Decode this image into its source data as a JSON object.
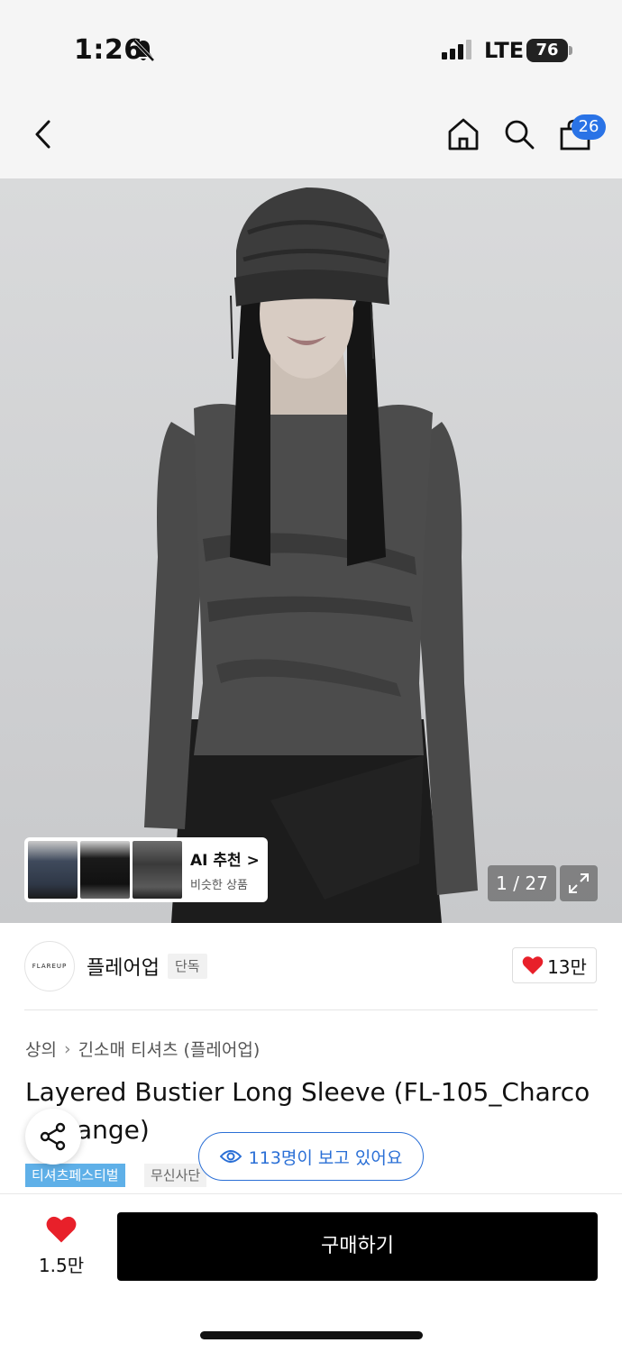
{
  "status_bar": {
    "time": "1:26",
    "network": "LTE",
    "battery": "76",
    "icons": [
      "bell-slash-icon",
      "signal-icon"
    ]
  },
  "header": {
    "back_icon": "chevron-left-icon",
    "home_icon": "home-icon",
    "search_icon": "search-icon",
    "cart_icon": "shopping-bag-icon",
    "cart_count": "26"
  },
  "gallery": {
    "counter": "1 / 27",
    "expand_icon": "expand-icon",
    "ai_recommend": {
      "title": "AI 추천 >",
      "subtitle": "비슷한 상품"
    }
  },
  "brand": {
    "logo_text": "FLAREUP",
    "name": "플레어업",
    "tag": "단독",
    "likes": "13만"
  },
  "product": {
    "breadcrumb": [
      "상의",
      "긴소매 티셔츠 (플레어업)"
    ],
    "title_line1": "Layered Bustier Long Sleeve (FL-105_Charco",
    "title_line2": "elange)",
    "tags": [
      "티셔츠페스티벌",
      "무신사단"
    ]
  },
  "viewers": {
    "label": "113명이 보고 있어요"
  },
  "bottom": {
    "wishlist_count": "1.5만",
    "buy_label": "구매하기"
  },
  "colors": {
    "accent_blue": "#2a6fd6",
    "badge_blue": "#2a73e6",
    "tag_blue": "#5fb0e8",
    "heart_red": "#e8202a",
    "buy_button": "#000000"
  }
}
